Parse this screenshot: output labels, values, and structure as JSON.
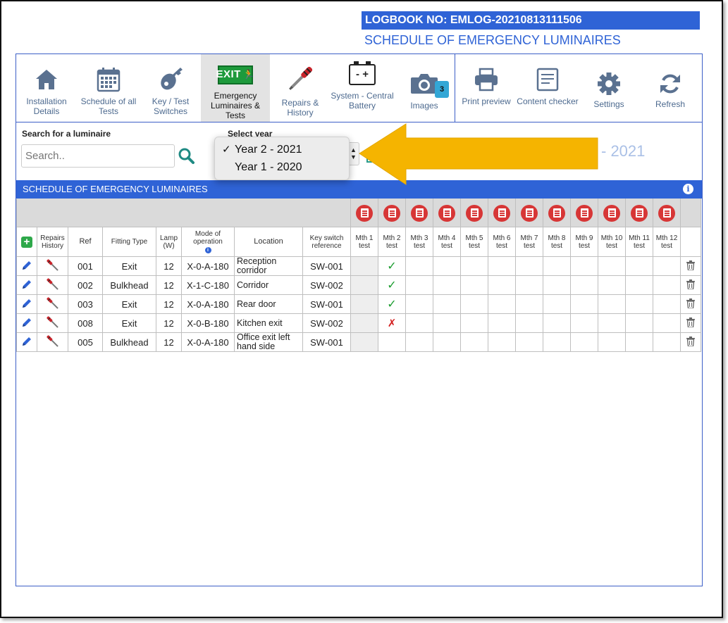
{
  "header": {
    "logbook": "LOGBOOK NO: EMLOG-20210813111506",
    "subtitle": "SCHEDULE OF EMERGENCY LUMINAIRES"
  },
  "toolbar": {
    "installation": "Installation Details",
    "schedule": "Schedule of all Tests",
    "key_test": "Key / Test Switches",
    "emergency": "Emergency Luminaires & Tests",
    "exit_sign": "EXIT",
    "repairs": "Repairs & History",
    "system": "System - Central Battery",
    "battery_sign": "- +",
    "images": "Images",
    "images_count": "3",
    "print": "Print preview",
    "content": "Content checker",
    "settings": "Settings",
    "refresh": "Refresh"
  },
  "search": {
    "label": "Search for a luminaire",
    "placeholder": "Search.."
  },
  "year": {
    "label": "Select year",
    "options": [
      "Year 2 - 2021",
      "Year 1 - 2020"
    ],
    "selected_check": "✓",
    "background_text": "- 2021"
  },
  "section": {
    "title": "SCHEDULE OF EMERGENCY LUMINAIRES",
    "info": "i"
  },
  "table": {
    "columns": {
      "repairs": "Repairs History",
      "ref": "Ref",
      "fitting": "Fitting Type",
      "lamp": "Lamp (W)",
      "mode": "Mode of operation",
      "location": "Location",
      "key_switch": "Key switch reference"
    },
    "months": [
      "Mth 1 test",
      "Mth 2 test",
      "Mth 3 test",
      "Mth 4 test",
      "Mth 5 test",
      "Mth 6 test",
      "Mth 7 test",
      "Mth 8 test",
      "Mth 9 test",
      "Mth 10 test",
      "Mth 11 test",
      "Mth 12 test"
    ],
    "rows": [
      {
        "ref": "001",
        "fitting": "Exit",
        "lamp": "12",
        "mode": "X-0-A-180",
        "location": "Reception corridor",
        "key": "SW-001",
        "mth2": "pass"
      },
      {
        "ref": "002",
        "fitting": "Bulkhead",
        "lamp": "12",
        "mode": "X-1-C-180",
        "location": "Corridor",
        "key": "SW-002",
        "mth2": "pass"
      },
      {
        "ref": "003",
        "fitting": "Exit",
        "lamp": "12",
        "mode": "X-0-A-180",
        "location": "Rear door",
        "key": "SW-001",
        "mth2": "pass"
      },
      {
        "ref": "008",
        "fitting": "Exit",
        "lamp": "12",
        "mode": "X-0-B-180",
        "location": "Kitchen exit",
        "key": "SW-002",
        "mth2": "fail"
      },
      {
        "ref": "005",
        "fitting": "Bulkhead",
        "lamp": "12",
        "mode": "X-0-A-180",
        "location": "Office exit left hand side",
        "key": "SW-001",
        "mth2": ""
      }
    ]
  },
  "colors": {
    "accent": "#2f63d6",
    "arrow": "#f5b400",
    "pass": "#1a9c2e",
    "fail": "#d42020"
  }
}
